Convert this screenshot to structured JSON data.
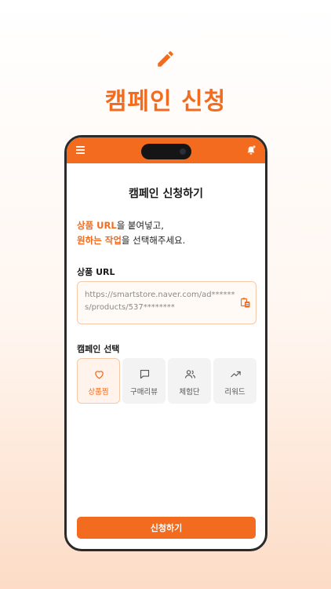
{
  "hero": {
    "title": "캠페인 신청",
    "icon": "pencil-icon"
  },
  "colors": {
    "accent": "#f26b1f",
    "accent_light": "#fff3eb"
  },
  "page": {
    "title": "캠페인 신청하기",
    "intro_line1_accent": "상품 URL",
    "intro_line1_rest": "을 붙여넣고,",
    "intro_line2_accent": "원하는 작업",
    "intro_line2_rest": "을 선택해주세요."
  },
  "url_section": {
    "label": "상품 URL",
    "value": "https://smartstore.naver.com/ad******s/products/537********"
  },
  "campaign_section": {
    "label": "캠페인 선택",
    "options": [
      {
        "label": "상품찜",
        "icon": "heart-icon",
        "selected": true
      },
      {
        "label": "구매리뷰",
        "icon": "chat-icon",
        "selected": false
      },
      {
        "label": "체험단",
        "icon": "users-icon",
        "selected": false
      },
      {
        "label": "리워드",
        "icon": "trending-up-icon",
        "selected": false
      }
    ]
  },
  "submit": {
    "label": "신청하기"
  }
}
